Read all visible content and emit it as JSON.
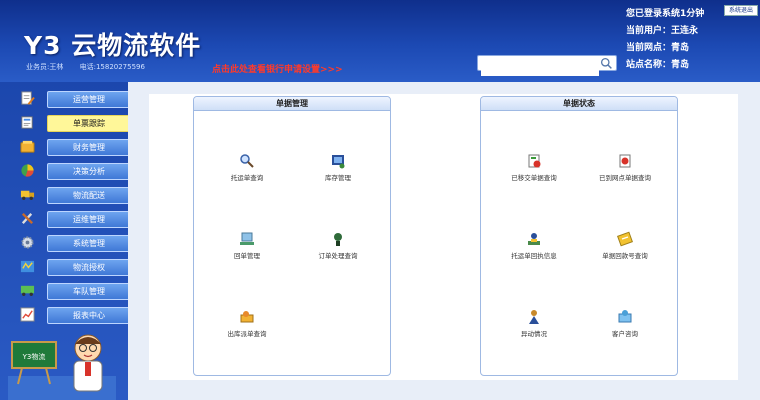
{
  "header": {
    "logo": "Y3 云物流软件",
    "contact_person": "业务员:王林",
    "contact_phone": "电话:15820275596",
    "promo": "点击此处查看银行申请设置>>>",
    "search_placeholder": "",
    "login_time": "您已登录系统1分钟",
    "logout_label": "系统退出",
    "current_user": "当前用户：王连永",
    "current_site": "当前网点：青岛",
    "station_name": "站点名称：青岛"
  },
  "sidebar": {
    "items": [
      {
        "label": "运营管理",
        "icon": "document-edit-icon",
        "active": false
      },
      {
        "label": "单票跟踪",
        "icon": "waybill-icon",
        "active": true
      },
      {
        "label": "财务管理",
        "icon": "wallet-icon",
        "active": false
      },
      {
        "label": "决策分析",
        "icon": "pie-chart-icon",
        "active": false
      },
      {
        "label": "物流配送",
        "icon": "truck-icon",
        "active": false
      },
      {
        "label": "运维管理",
        "icon": "tools-icon",
        "active": false
      },
      {
        "label": "系统管理",
        "icon": "gear-icon",
        "active": false
      },
      {
        "label": "物流授权",
        "icon": "map-icon",
        "active": false
      },
      {
        "label": "车队管理",
        "icon": "fleet-icon",
        "active": false
      },
      {
        "label": "报表中心",
        "icon": "report-chart-icon",
        "active": false
      }
    ],
    "mascot_sign": "Y3物流"
  },
  "panels": {
    "left": {
      "title": "单据管理",
      "tiles": [
        {
          "label": "托运单查询",
          "icon": "magnifier-icon"
        },
        {
          "label": "库存管理",
          "icon": "inventory-icon"
        },
        {
          "label": "回单管理",
          "icon": "receipt-return-icon"
        },
        {
          "label": "订单处理查询",
          "icon": "order-query-icon"
        },
        {
          "label": "出库派单查询",
          "icon": "dispatch-query-icon"
        }
      ]
    },
    "right": {
      "title": "单据状态",
      "tiles": [
        {
          "label": "已移交单据查询",
          "icon": "transfer-doc-icon"
        },
        {
          "label": "已到网点单据查询",
          "icon": "arrived-doc-icon"
        },
        {
          "label": "托运单回执信息",
          "icon": "receipt-info-icon"
        },
        {
          "label": "单据回款号查询",
          "icon": "payment-code-icon"
        },
        {
          "label": "异动情况",
          "icon": "exception-icon"
        },
        {
          "label": "客户咨询",
          "icon": "customer-service-icon"
        }
      ]
    }
  },
  "colors": {
    "header_dark": "#0f2f8c",
    "sidebar": "#1c47ad",
    "nav_button": "#3f78d6",
    "nav_active": "#fff799",
    "promo_red": "#ff3a2a",
    "panel_border": "#9fb9e3"
  }
}
